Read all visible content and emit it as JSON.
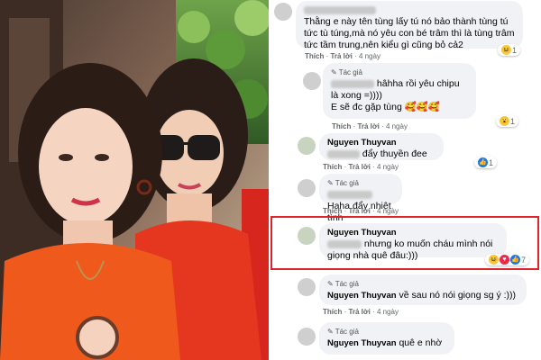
{
  "comments": [
    {
      "text": "Thằng e này tên tùng lấy tú nó bảo thành tùng tú tức tù túng,mà nó yêu con bé trâm thì là tùng trâm tức tầm trung,nên kiểu gì cũng bỏ cả2",
      "actions": {
        "like": "Thích",
        "reply": "Trả lời",
        "time": "4 ngày"
      },
      "reaction_count": "1"
    },
    {
      "author_tag": "Tác giả",
      "text": "hâhha rồi yêu chipu là xong =))))\nE sẽ đc gặp tùng 🥰🥰🥰",
      "actions": {
        "like": "Thích",
        "reply": "Trả lời",
        "time": "4 ngày"
      },
      "reaction_count": "1"
    },
    {
      "name": "Nguyen Thuyvan",
      "text": "đẩy thuyền đee",
      "actions": {
        "like": "Thích",
        "reply": "Trả lời",
        "time": "4 ngày"
      },
      "reaction_count": "1"
    },
    {
      "author_tag": "Tác giả",
      "text": "Haha đẩy nhiệt tình",
      "actions": {
        "like": "Thích",
        "reply": "Trả lời",
        "time": "4 ngày"
      }
    },
    {
      "name": "Nguyen Thuyvan",
      "text": "nhưng ko muốn cháu mình nói giọng nhà quê đâu:)))",
      "actions": {
        "like": "Thích",
        "reply": "Trả lời",
        "time": "4 ngày"
      },
      "reaction_count": "7"
    },
    {
      "author_tag": "Tác giả",
      "name": "Nguyen Thuyvan",
      "text": "về sau nó nói giọng sg ý :)))",
      "actions": {
        "like": "Thích",
        "reply": "Trả lời",
        "time": "4 ngày"
      }
    },
    {
      "author_tag": "Tác giả",
      "name": "Nguyen Thuyvan",
      "text": "quê e nhờ"
    }
  ],
  "colors": {
    "highlight": "#e0222a",
    "bubble": "#f0f2f5",
    "link": "#65676b"
  }
}
